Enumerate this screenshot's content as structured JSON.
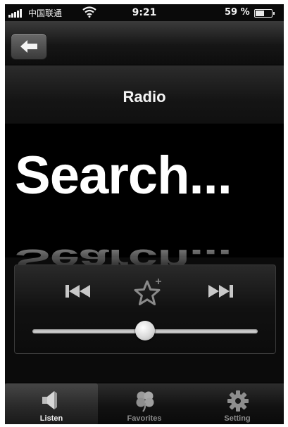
{
  "status_bar": {
    "carrier": "中国联通",
    "time": "9:21",
    "battery_percent": "59 %",
    "battery_level": 0.59,
    "icons": [
      "signal-icon",
      "wifi-icon",
      "battery-icon"
    ]
  },
  "nav": {
    "back_icon": "arrow-left-icon"
  },
  "header": {
    "title": "Radio"
  },
  "display": {
    "status_text": "Search..."
  },
  "controls": {
    "icons": [
      "previous-track-icon",
      "favorite-star-add-icon",
      "next-track-icon"
    ],
    "volume_level": 0.5
  },
  "tabs": [
    {
      "label": "Listen",
      "icon": "speaker-icon",
      "selected": true
    },
    {
      "label": "Favorites",
      "icon": "clover-icon",
      "selected": false
    },
    {
      "label": "Setting",
      "icon": "gear-icon",
      "selected": false
    }
  ],
  "colors": {
    "background": "#0b0b0b",
    "text": "#ffffff",
    "tab_inactive": "#8c8c8c"
  }
}
